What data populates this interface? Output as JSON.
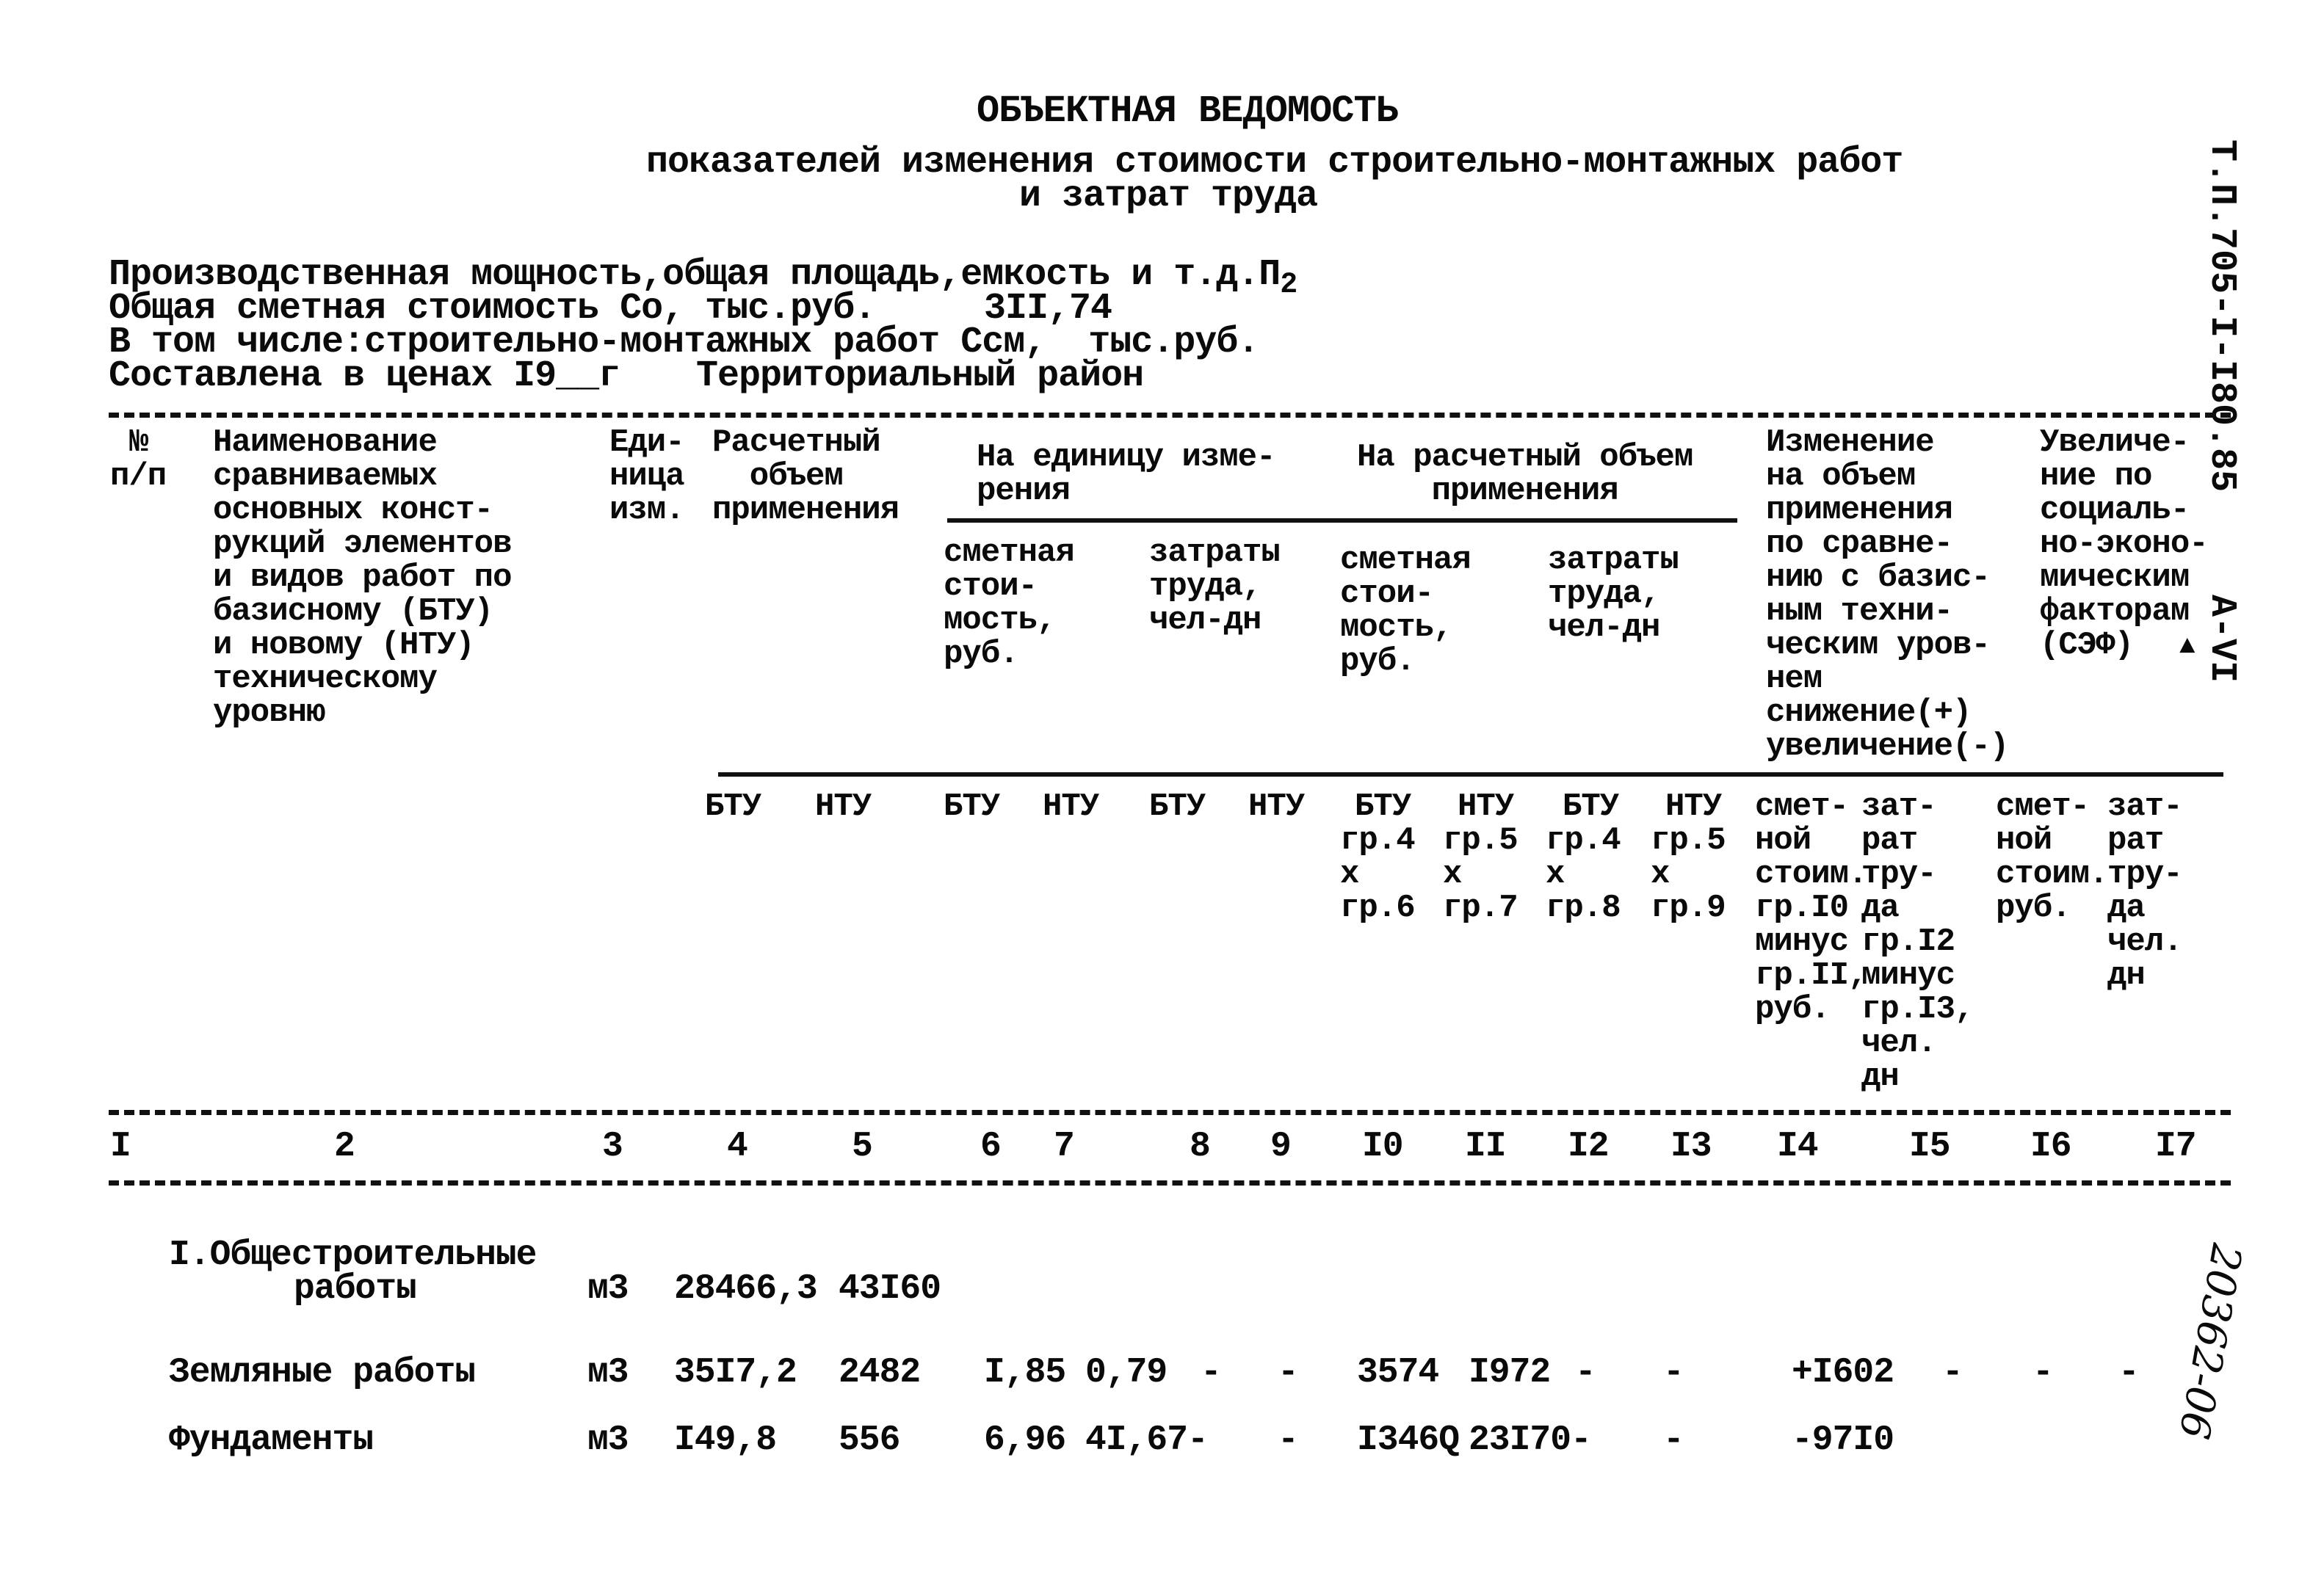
{
  "document": {
    "title": "ОБЪЕКТНАЯ ВЕДОМОСТЬ",
    "subtitle_line1": "показателей изменения стоимости строительно-монтажных работ",
    "subtitle_line2": "и затрат труда",
    "side_code": "Т.П.705-I-I80.85",
    "side_album": "А-VI",
    "handwritten_number": "20362-06",
    "mark_glyph": "▲"
  },
  "info": {
    "line1": "Производственная мощность,общая площадь,емкость и т.д.",
    "line1_suffix": "П",
    "line1_subscript": "2",
    "line2_label": "Общая сметная стоимость Со, тыс.руб.",
    "line2_value": "3II,74",
    "line3": "В том числе:строительно-монтажных работ Ссм,  тыс.руб.",
    "line4_label": "Составлена в ценах I9__г",
    "line4_region": "Территориальный район"
  },
  "header": {
    "col_num": [
      "№",
      "п/п"
    ],
    "col_name": [
      "Наименование",
      "сравниваемых",
      "основных конст-",
      "рукций элементов",
      "и видов работ по",
      "базисному (БТУ)",
      "и новому (НТУ)",
      "техническому",
      "уровню"
    ],
    "col_unit": [
      "Еди-",
      "ница",
      "изм."
    ],
    "col_volume": [
      "Расчетный",
      "  объем",
      "применения"
    ],
    "group_per_unit": [
      "На единицу изме-",
      "рения"
    ],
    "group_per_volume": [
      "На расчетный объем",
      "    применения"
    ],
    "sub_cost": [
      "сметная",
      "стои-",
      "мость,",
      "руб."
    ],
    "sub_labor": [
      "затраты",
      "труда,",
      "чел-дн"
    ],
    "col_change": [
      "Изменение",
      "на объем",
      "применения",
      "по сравне-",
      "нию с базис-",
      "ным техни-",
      "ческим уров-",
      "нем",
      "снижение(+)",
      "увеличение(-)"
    ],
    "col_social": [
      "Увеличе-",
      "ние по",
      "социаль-",
      "но-эконо-",
      "мическим",
      "факторам",
      "(СЭФ)"
    ],
    "btu": "БТУ",
    "ntu": "НТУ",
    "formula_10": [
      "гр.4",
      "х",
      "гр.6"
    ],
    "formula_11": [
      "гр.5",
      "х",
      "гр.7"
    ],
    "formula_12": [
      "гр.4",
      "х",
      "гр.8"
    ],
    "formula_13": [
      "гр.5",
      "х",
      "гр.9"
    ],
    "sub_14": [
      "смет-",
      "ной",
      "стоим.",
      "гр.I0",
      "минус",
      "гр.II,",
      "руб."
    ],
    "sub_15": [
      "зат-",
      "рат",
      "тру-",
      "да",
      "гр.I2",
      "минус",
      "гр.I3,",
      "чел.",
      "дн"
    ],
    "sub_16": [
      "смет-",
      "ной",
      "стоим.",
      "руб."
    ],
    "sub_17": [
      "зат-",
      "рат",
      "тру-",
      "да",
      "чел.",
      "дн"
    ]
  },
  "column_numbers": [
    "I",
    "2",
    "3",
    "4",
    "5",
    "6",
    "7",
    "8",
    "9",
    "I0",
    "II",
    "I2",
    "I3",
    "I4",
    "I5",
    "I6",
    "I7"
  ],
  "rows": [
    {
      "name_line1": "I.Общестроительные",
      "name_line2": "работы",
      "unit": "м3",
      "c4": "28466,3",
      "c5": "43I60"
    },
    {
      "name": "Земляные работы",
      "unit": "м3",
      "c4": "35I7,2",
      "c5": "2482",
      "c6": "I,85",
      "c7": "0,79",
      "c8": "-",
      "c9": "-",
      "c10": "3574",
      "c11": "I972",
      "c12": "-",
      "c13": "-",
      "c14": "+I602",
      "c15": "-",
      "c16": "-",
      "c17": "-"
    },
    {
      "name": "Фундаменты",
      "unit": "м3",
      "c4": "I49,8",
      "c5": "556",
      "c6": "6,96",
      "c7": "4I,67-",
      "c9": "-",
      "c10": "I346Q",
      "c11": "23I70-",
      "c13": "-",
      "c14": "-97I0"
    }
  ]
}
